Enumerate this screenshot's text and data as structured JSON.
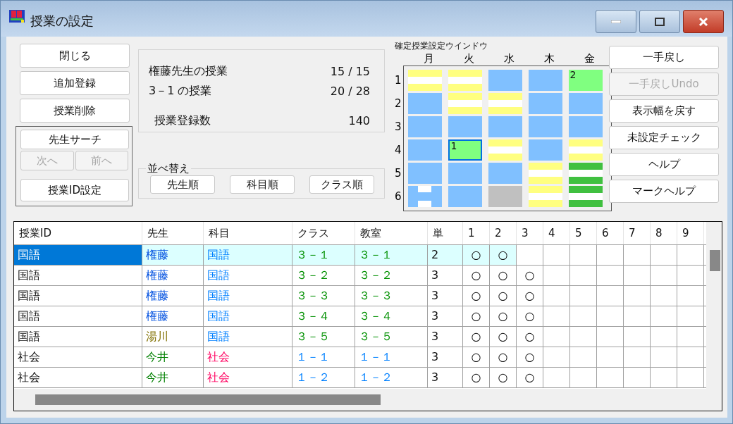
{
  "window": {
    "title": "授業の設定"
  },
  "left_buttons": [
    {
      "label": "閉じる",
      "disabled": false
    },
    {
      "label": "追加登録",
      "disabled": false
    },
    {
      "label": "授業削除",
      "disabled": false
    }
  ],
  "search_group": {
    "search_button": {
      "label": "先生サーチ",
      "disabled": false
    },
    "nav_buttons": [
      {
        "label": "次へ",
        "disabled": true
      },
      {
        "label": "前へ",
        "disabled": true
      }
    ],
    "id_button": {
      "label": "授業ID設定",
      "disabled": false
    }
  },
  "summary": [
    {
      "label": "権藤先生の授業",
      "value": "15 / 15"
    },
    {
      "label": "3－1 の授業",
      "value": "20 / 28"
    },
    {
      "label": "授業登録数",
      "value": "140"
    }
  ],
  "sort": {
    "title": "並べ替え",
    "buttons": [
      "先生順",
      "科目順",
      "クラス順"
    ]
  },
  "schedule": {
    "title": "確定授業設定ウインドウ",
    "days": [
      "月",
      "火",
      "水",
      "木",
      "金"
    ],
    "periods": [
      "1",
      "2",
      "3",
      "4",
      "5",
      "6"
    ],
    "rows": [
      [
        {
          "kind": "stripe",
          "selected": false
        },
        {
          "kind": "stripe",
          "selected": false
        },
        {
          "kind": "free",
          "selected": false
        },
        {
          "kind": "free",
          "selected": false
        },
        {
          "kind": "fixed",
          "label": "2",
          "selected": false
        }
      ],
      [
        {
          "kind": "free",
          "selected": false
        },
        {
          "kind": "stripe",
          "selected": false
        },
        {
          "kind": "stripe",
          "selected": false
        },
        {
          "kind": "free",
          "selected": false
        },
        {
          "kind": "free",
          "selected": false
        }
      ],
      [
        {
          "kind": "free",
          "selected": false
        },
        {
          "kind": "free",
          "selected": false
        },
        {
          "kind": "free",
          "selected": false
        },
        {
          "kind": "free",
          "selected": false
        },
        {
          "kind": "free",
          "selected": false
        }
      ],
      [
        {
          "kind": "free",
          "selected": false
        },
        {
          "kind": "fixed",
          "label": "1",
          "selected": true
        },
        {
          "kind": "stripe",
          "selected": false
        },
        {
          "kind": "free",
          "selected": false
        },
        {
          "kind": "stripe",
          "selected": false
        }
      ],
      [
        {
          "kind": "free",
          "selected": false
        },
        {
          "kind": "free",
          "selected": false
        },
        {
          "kind": "free",
          "selected": false
        },
        {
          "kind": "stripe",
          "selected": false
        },
        {
          "kind": "greenstripe",
          "selected": false
        }
      ],
      [
        {
          "kind": "split",
          "selected": false
        },
        {
          "kind": "free",
          "selected": false
        },
        {
          "kind": "blocked",
          "selected": false
        },
        {
          "kind": "stripe",
          "selected": false
        },
        {
          "kind": "greenstripe",
          "selected": false
        }
      ]
    ]
  },
  "right_buttons": [
    {
      "label": "一手戻し",
      "disabled": false
    },
    {
      "label": "一手戻しUndo",
      "disabled": true
    },
    {
      "label": "表示幅を戻す",
      "disabled": false
    },
    {
      "label": "未設定チェック",
      "disabled": false
    },
    {
      "label": "ヘルプ",
      "disabled": false
    },
    {
      "label": "マークヘルプ",
      "disabled": false
    }
  ],
  "table": {
    "columns": [
      "授業ID",
      "先生",
      "科目",
      "クラス",
      "教室",
      "単",
      "1",
      "2",
      "3",
      "4",
      "5",
      "6",
      "7",
      "8",
      "9"
    ],
    "rows": [
      {
        "selected": true,
        "id": "国語",
        "teacher": {
          "text": "権藤",
          "color": "#0050e0"
        },
        "subject": {
          "text": "国語",
          "color": "#0080ff"
        },
        "class": {
          "text": "３－１",
          "color": "#009000"
        },
        "room": {
          "text": "３－１",
          "color": "#009000"
        },
        "units": "2",
        "marks": [
          "○",
          "○"
        ]
      },
      {
        "selected": false,
        "id": "国語",
        "teacher": {
          "text": "権藤",
          "color": "#0050e0"
        },
        "subject": {
          "text": "国語",
          "color": "#0080ff"
        },
        "class": {
          "text": "３－２",
          "color": "#009000"
        },
        "room": {
          "text": "３－２",
          "color": "#009000"
        },
        "units": "3",
        "marks": [
          "○",
          "○",
          "○"
        ]
      },
      {
        "selected": false,
        "id": "国語",
        "teacher": {
          "text": "権藤",
          "color": "#0050e0"
        },
        "subject": {
          "text": "国語",
          "color": "#0080ff"
        },
        "class": {
          "text": "３－３",
          "color": "#009000"
        },
        "room": {
          "text": "３－３",
          "color": "#009000"
        },
        "units": "3",
        "marks": [
          "○",
          "○",
          "○"
        ]
      },
      {
        "selected": false,
        "id": "国語",
        "teacher": {
          "text": "権藤",
          "color": "#0050e0"
        },
        "subject": {
          "text": "国語",
          "color": "#0080ff"
        },
        "class": {
          "text": "３－４",
          "color": "#009000"
        },
        "room": {
          "text": "３－４",
          "color": "#009000"
        },
        "units": "3",
        "marks": [
          "○",
          "○",
          "○"
        ]
      },
      {
        "selected": false,
        "id": "国語",
        "teacher": {
          "text": "湯川",
          "color": "#807000"
        },
        "subject": {
          "text": "国語",
          "color": "#0080ff"
        },
        "class": {
          "text": "３－５",
          "color": "#009000"
        },
        "room": {
          "text": "３－５",
          "color": "#009000"
        },
        "units": "3",
        "marks": [
          "○",
          "○",
          "○"
        ]
      },
      {
        "selected": false,
        "id": "社会",
        "teacher": {
          "text": "今井",
          "color": "#008000"
        },
        "subject": {
          "text": "社会",
          "color": "#ff0060"
        },
        "class": {
          "text": "１－１",
          "color": "#0080ff"
        },
        "room": {
          "text": "１－１",
          "color": "#0080ff"
        },
        "units": "3",
        "marks": [
          "○",
          "○",
          "○"
        ]
      },
      {
        "selected": false,
        "id": "社会",
        "teacher": {
          "text": "今井",
          "color": "#008000"
        },
        "subject": {
          "text": "社会",
          "color": "#ff0060"
        },
        "class": {
          "text": "１－２",
          "color": "#0080ff"
        },
        "room": {
          "text": "１－２",
          "color": "#0080ff"
        },
        "units": "3",
        "marks": [
          "○",
          "○",
          "○"
        ]
      }
    ]
  }
}
